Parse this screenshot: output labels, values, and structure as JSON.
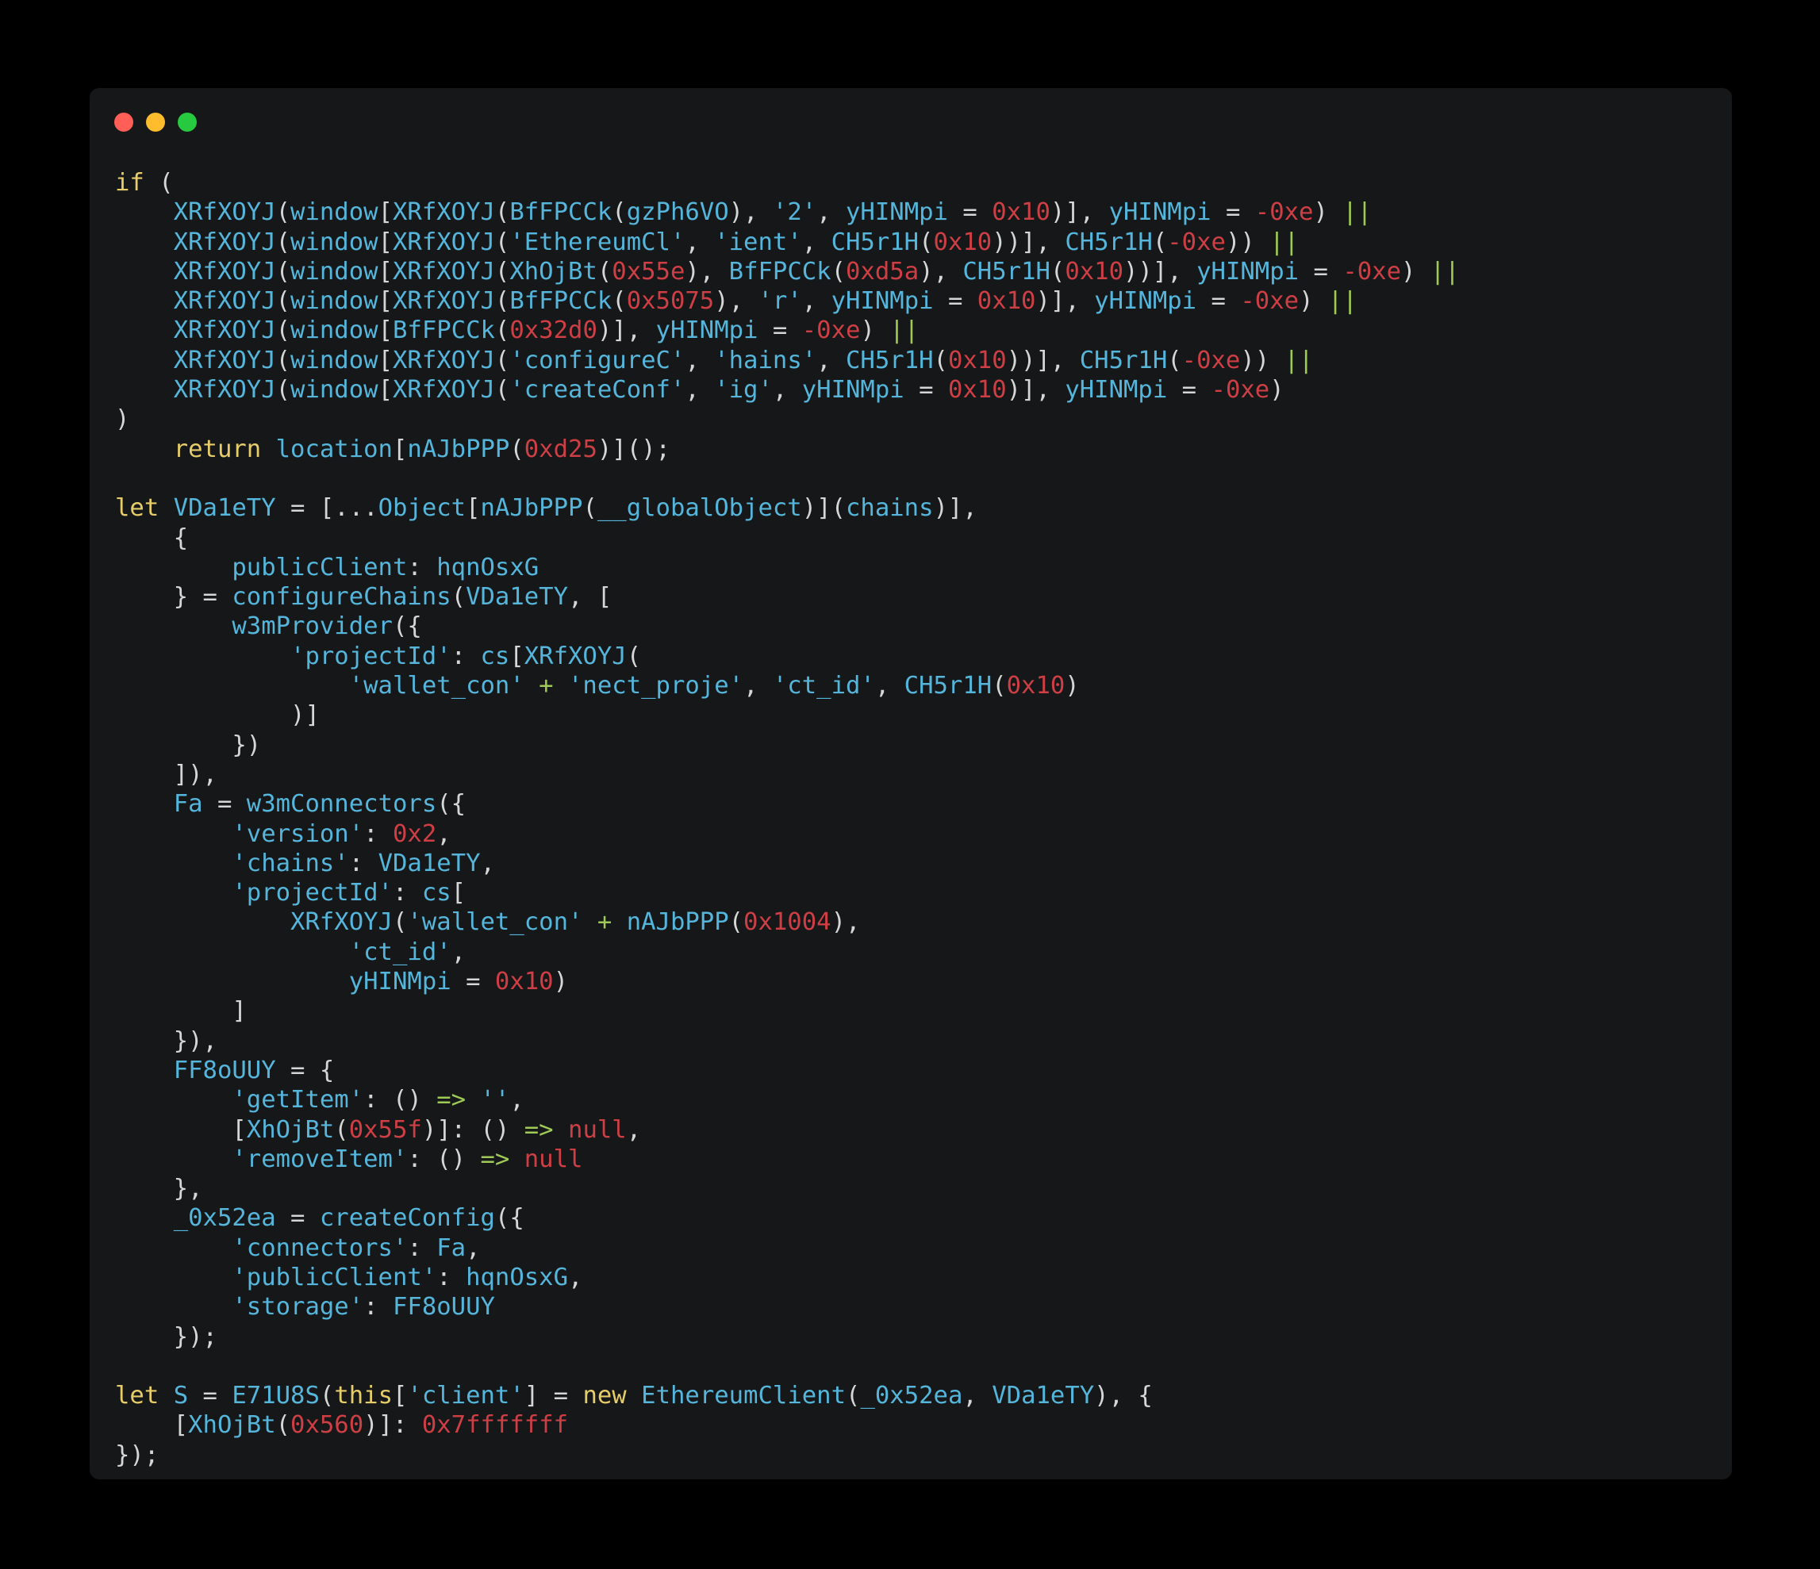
{
  "window": {
    "traffic_lights": [
      {
        "name": "close",
        "color": "#ff5f56"
      },
      {
        "name": "minimize",
        "color": "#ffbd2e"
      },
      {
        "name": "maximize",
        "color": "#27c93f"
      }
    ]
  },
  "colors": {
    "background": "#000000",
    "window": "#151718",
    "plain": "#d4d7d6",
    "keyword": "#e6cd69",
    "identifier": "#55b5db",
    "number": "#cd3f45",
    "operator": "#9fca56"
  },
  "code": {
    "lines": [
      [
        [
          "kw",
          "if"
        ],
        [
          "p",
          " ("
        ]
      ],
      [
        [
          "p",
          "    "
        ],
        [
          "id",
          "XRfXOYJ"
        ],
        [
          "p",
          "("
        ],
        [
          "id",
          "window"
        ],
        [
          "p",
          "["
        ],
        [
          "id",
          "XRfXOYJ"
        ],
        [
          "p",
          "("
        ],
        [
          "id",
          "BfFPCCk"
        ],
        [
          "p",
          "("
        ],
        [
          "id",
          "gzPh6VO"
        ],
        [
          "p",
          "), "
        ],
        [
          "str",
          "'2'"
        ],
        [
          "p",
          ", "
        ],
        [
          "id",
          "yHINMpi"
        ],
        [
          "p",
          " = "
        ],
        [
          "num",
          "0x10"
        ],
        [
          "p",
          ")], "
        ],
        [
          "id",
          "yHINMpi"
        ],
        [
          "p",
          " = "
        ],
        [
          "num",
          "-0xe"
        ],
        [
          "p",
          ") "
        ],
        [
          "op",
          "||"
        ]
      ],
      [
        [
          "p",
          "    "
        ],
        [
          "id",
          "XRfXOYJ"
        ],
        [
          "p",
          "("
        ],
        [
          "id",
          "window"
        ],
        [
          "p",
          "["
        ],
        [
          "id",
          "XRfXOYJ"
        ],
        [
          "p",
          "("
        ],
        [
          "str",
          "'EthereumCl'"
        ],
        [
          "p",
          ", "
        ],
        [
          "str",
          "'ient'"
        ],
        [
          "p",
          ", "
        ],
        [
          "id",
          "CH5r1H"
        ],
        [
          "p",
          "("
        ],
        [
          "num",
          "0x10"
        ],
        [
          "p",
          "))], "
        ],
        [
          "id",
          "CH5r1H"
        ],
        [
          "p",
          "("
        ],
        [
          "num",
          "-0xe"
        ],
        [
          "p",
          ")) "
        ],
        [
          "op",
          "||"
        ]
      ],
      [
        [
          "p",
          "    "
        ],
        [
          "id",
          "XRfXOYJ"
        ],
        [
          "p",
          "("
        ],
        [
          "id",
          "window"
        ],
        [
          "p",
          "["
        ],
        [
          "id",
          "XRfXOYJ"
        ],
        [
          "p",
          "("
        ],
        [
          "id",
          "XhOjBt"
        ],
        [
          "p",
          "("
        ],
        [
          "num",
          "0x55e"
        ],
        [
          "p",
          "), "
        ],
        [
          "id",
          "BfFPCCk"
        ],
        [
          "p",
          "("
        ],
        [
          "num",
          "0xd5a"
        ],
        [
          "p",
          "), "
        ],
        [
          "id",
          "CH5r1H"
        ],
        [
          "p",
          "("
        ],
        [
          "num",
          "0x10"
        ],
        [
          "p",
          "))], "
        ],
        [
          "id",
          "yHINMpi"
        ],
        [
          "p",
          " = "
        ],
        [
          "num",
          "-0xe"
        ],
        [
          "p",
          ") "
        ],
        [
          "op",
          "||"
        ]
      ],
      [
        [
          "p",
          "    "
        ],
        [
          "id",
          "XRfXOYJ"
        ],
        [
          "p",
          "("
        ],
        [
          "id",
          "window"
        ],
        [
          "p",
          "["
        ],
        [
          "id",
          "XRfXOYJ"
        ],
        [
          "p",
          "("
        ],
        [
          "id",
          "BfFPCCk"
        ],
        [
          "p",
          "("
        ],
        [
          "num",
          "0x5075"
        ],
        [
          "p",
          "), "
        ],
        [
          "str",
          "'r'"
        ],
        [
          "p",
          ", "
        ],
        [
          "id",
          "yHINMpi"
        ],
        [
          "p",
          " = "
        ],
        [
          "num",
          "0x10"
        ],
        [
          "p",
          ")], "
        ],
        [
          "id",
          "yHINMpi"
        ],
        [
          "p",
          " = "
        ],
        [
          "num",
          "-0xe"
        ],
        [
          "p",
          ") "
        ],
        [
          "op",
          "||"
        ]
      ],
      [
        [
          "p",
          "    "
        ],
        [
          "id",
          "XRfXOYJ"
        ],
        [
          "p",
          "("
        ],
        [
          "id",
          "window"
        ],
        [
          "p",
          "["
        ],
        [
          "id",
          "BfFPCCk"
        ],
        [
          "p",
          "("
        ],
        [
          "num",
          "0x32d0"
        ],
        [
          "p",
          ")], "
        ],
        [
          "id",
          "yHINMpi"
        ],
        [
          "p",
          " = "
        ],
        [
          "num",
          "-0xe"
        ],
        [
          "p",
          ") "
        ],
        [
          "op",
          "||"
        ]
      ],
      [
        [
          "p",
          "    "
        ],
        [
          "id",
          "XRfXOYJ"
        ],
        [
          "p",
          "("
        ],
        [
          "id",
          "window"
        ],
        [
          "p",
          "["
        ],
        [
          "id",
          "XRfXOYJ"
        ],
        [
          "p",
          "("
        ],
        [
          "str",
          "'configureC'"
        ],
        [
          "p",
          ", "
        ],
        [
          "str",
          "'hains'"
        ],
        [
          "p",
          ", "
        ],
        [
          "id",
          "CH5r1H"
        ],
        [
          "p",
          "("
        ],
        [
          "num",
          "0x10"
        ],
        [
          "p",
          "))], "
        ],
        [
          "id",
          "CH5r1H"
        ],
        [
          "p",
          "("
        ],
        [
          "num",
          "-0xe"
        ],
        [
          "p",
          ")) "
        ],
        [
          "op",
          "||"
        ]
      ],
      [
        [
          "p",
          "    "
        ],
        [
          "id",
          "XRfXOYJ"
        ],
        [
          "p",
          "("
        ],
        [
          "id",
          "window"
        ],
        [
          "p",
          "["
        ],
        [
          "id",
          "XRfXOYJ"
        ],
        [
          "p",
          "("
        ],
        [
          "str",
          "'createConf'"
        ],
        [
          "p",
          ", "
        ],
        [
          "str",
          "'ig'"
        ],
        [
          "p",
          ", "
        ],
        [
          "id",
          "yHINMpi"
        ],
        [
          "p",
          " = "
        ],
        [
          "num",
          "0x10"
        ],
        [
          "p",
          ")], "
        ],
        [
          "id",
          "yHINMpi"
        ],
        [
          "p",
          " = "
        ],
        [
          "num",
          "-0xe"
        ],
        [
          "p",
          ")"
        ]
      ],
      [
        [
          "p",
          ")"
        ]
      ],
      [
        [
          "p",
          "    "
        ],
        [
          "kw",
          "return"
        ],
        [
          "p",
          " "
        ],
        [
          "id",
          "location"
        ],
        [
          "p",
          "["
        ],
        [
          "id",
          "nAJbPPP"
        ],
        [
          "p",
          "("
        ],
        [
          "num",
          "0xd25"
        ],
        [
          "p",
          ")]();"
        ]
      ],
      [],
      [
        [
          "kw",
          "let"
        ],
        [
          "p",
          " "
        ],
        [
          "id",
          "VDa1eTY"
        ],
        [
          "p",
          " = [..."
        ],
        [
          "id",
          "Object"
        ],
        [
          "p",
          "["
        ],
        [
          "id",
          "nAJbPPP"
        ],
        [
          "p",
          "("
        ],
        [
          "id",
          "__globalObject"
        ],
        [
          "p",
          ")]("
        ],
        [
          "id",
          "chains"
        ],
        [
          "p",
          ")],"
        ]
      ],
      [
        [
          "p",
          "    {"
        ]
      ],
      [
        [
          "p",
          "        "
        ],
        [
          "id",
          "publicClient"
        ],
        [
          "p",
          ": "
        ],
        [
          "id",
          "hqnOsxG"
        ]
      ],
      [
        [
          "p",
          "    } = "
        ],
        [
          "id",
          "configureChains"
        ],
        [
          "p",
          "("
        ],
        [
          "id",
          "VDa1eTY"
        ],
        [
          "p",
          ", ["
        ]
      ],
      [
        [
          "p",
          "        "
        ],
        [
          "id",
          "w3mProvider"
        ],
        [
          "p",
          "({"
        ]
      ],
      [
        [
          "p",
          "            "
        ],
        [
          "str",
          "'projectId'"
        ],
        [
          "p",
          ": "
        ],
        [
          "id",
          "cs"
        ],
        [
          "p",
          "["
        ],
        [
          "id",
          "XRfXOYJ"
        ],
        [
          "p",
          "("
        ]
      ],
      [
        [
          "p",
          "                "
        ],
        [
          "str",
          "'wallet_con'"
        ],
        [
          "p",
          " "
        ],
        [
          "op",
          "+"
        ],
        [
          "p",
          " "
        ],
        [
          "str",
          "'nect_proje'"
        ],
        [
          "p",
          ", "
        ],
        [
          "str",
          "'ct_id'"
        ],
        [
          "p",
          ", "
        ],
        [
          "id",
          "CH5r1H"
        ],
        [
          "p",
          "("
        ],
        [
          "num",
          "0x10"
        ],
        [
          "p",
          ")"
        ]
      ],
      [
        [
          "p",
          "            )]"
        ]
      ],
      [
        [
          "p",
          "        })"
        ]
      ],
      [
        [
          "p",
          "    ]),"
        ]
      ],
      [
        [
          "p",
          "    "
        ],
        [
          "id",
          "Fa"
        ],
        [
          "p",
          " = "
        ],
        [
          "id",
          "w3mConnectors"
        ],
        [
          "p",
          "({"
        ]
      ],
      [
        [
          "p",
          "        "
        ],
        [
          "str",
          "'version'"
        ],
        [
          "p",
          ": "
        ],
        [
          "num",
          "0x2"
        ],
        [
          "p",
          ","
        ]
      ],
      [
        [
          "p",
          "        "
        ],
        [
          "str",
          "'chains'"
        ],
        [
          "p",
          ": "
        ],
        [
          "id",
          "VDa1eTY"
        ],
        [
          "p",
          ","
        ]
      ],
      [
        [
          "p",
          "        "
        ],
        [
          "str",
          "'projectId'"
        ],
        [
          "p",
          ": "
        ],
        [
          "id",
          "cs"
        ],
        [
          "p",
          "["
        ]
      ],
      [
        [
          "p",
          "            "
        ],
        [
          "id",
          "XRfXOYJ"
        ],
        [
          "p",
          "("
        ],
        [
          "str",
          "'wallet_con'"
        ],
        [
          "p",
          " "
        ],
        [
          "op",
          "+"
        ],
        [
          "p",
          " "
        ],
        [
          "id",
          "nAJbPPP"
        ],
        [
          "p",
          "("
        ],
        [
          "num",
          "0x1004"
        ],
        [
          "p",
          "),"
        ]
      ],
      [
        [
          "p",
          "                "
        ],
        [
          "str",
          "'ct_id'"
        ],
        [
          "p",
          ","
        ]
      ],
      [
        [
          "p",
          "                "
        ],
        [
          "id",
          "yHINMpi"
        ],
        [
          "p",
          " = "
        ],
        [
          "num",
          "0x10"
        ],
        [
          "p",
          ")"
        ]
      ],
      [
        [
          "p",
          "        ]"
        ]
      ],
      [
        [
          "p",
          "    }),"
        ]
      ],
      [
        [
          "p",
          "    "
        ],
        [
          "id",
          "FF8oUUY"
        ],
        [
          "p",
          " = {"
        ]
      ],
      [
        [
          "p",
          "        "
        ],
        [
          "str",
          "'getItem'"
        ],
        [
          "p",
          ": () "
        ],
        [
          "op",
          "=>"
        ],
        [
          "p",
          " "
        ],
        [
          "str",
          "''"
        ],
        [
          "p",
          ","
        ]
      ],
      [
        [
          "p",
          "        ["
        ],
        [
          "id",
          "XhOjBt"
        ],
        [
          "p",
          "("
        ],
        [
          "num",
          "0x55f"
        ],
        [
          "p",
          ")]: () "
        ],
        [
          "op",
          "=>"
        ],
        [
          "p",
          " "
        ],
        [
          "null",
          "null"
        ],
        [
          "p",
          ","
        ]
      ],
      [
        [
          "p",
          "        "
        ],
        [
          "str",
          "'removeItem'"
        ],
        [
          "p",
          ": () "
        ],
        [
          "op",
          "=>"
        ],
        [
          "p",
          " "
        ],
        [
          "null",
          "null"
        ]
      ],
      [
        [
          "p",
          "    },"
        ]
      ],
      [
        [
          "p",
          "    "
        ],
        [
          "id",
          "_0x52ea"
        ],
        [
          "p",
          " = "
        ],
        [
          "id",
          "createConfig"
        ],
        [
          "p",
          "({"
        ]
      ],
      [
        [
          "p",
          "        "
        ],
        [
          "str",
          "'connectors'"
        ],
        [
          "p",
          ": "
        ],
        [
          "id",
          "Fa"
        ],
        [
          "p",
          ","
        ]
      ],
      [
        [
          "p",
          "        "
        ],
        [
          "str",
          "'publicClient'"
        ],
        [
          "p",
          ": "
        ],
        [
          "id",
          "hqnOsxG"
        ],
        [
          "p",
          ","
        ]
      ],
      [
        [
          "p",
          "        "
        ],
        [
          "str",
          "'storage'"
        ],
        [
          "p",
          ": "
        ],
        [
          "id",
          "FF8oUUY"
        ]
      ],
      [
        [
          "p",
          "    });"
        ]
      ],
      [],
      [
        [
          "kw",
          "let"
        ],
        [
          "p",
          " "
        ],
        [
          "id",
          "S"
        ],
        [
          "p",
          " = "
        ],
        [
          "id",
          "E71U8S"
        ],
        [
          "p",
          "("
        ],
        [
          "kw",
          "this"
        ],
        [
          "p",
          "["
        ],
        [
          "str",
          "'client'"
        ],
        [
          "p",
          "] = "
        ],
        [
          "kw",
          "new"
        ],
        [
          "p",
          " "
        ],
        [
          "id",
          "EthereumClient"
        ],
        [
          "p",
          "("
        ],
        [
          "id",
          "_0x52ea"
        ],
        [
          "p",
          ", "
        ],
        [
          "id",
          "VDa1eTY"
        ],
        [
          "p",
          "), {"
        ]
      ],
      [
        [
          "p",
          "    ["
        ],
        [
          "id",
          "XhOjBt"
        ],
        [
          "p",
          "("
        ],
        [
          "num",
          "0x560"
        ],
        [
          "p",
          ")]: "
        ],
        [
          "num",
          "0x7fffffff"
        ]
      ],
      [
        [
          "p",
          "});"
        ]
      ]
    ]
  }
}
